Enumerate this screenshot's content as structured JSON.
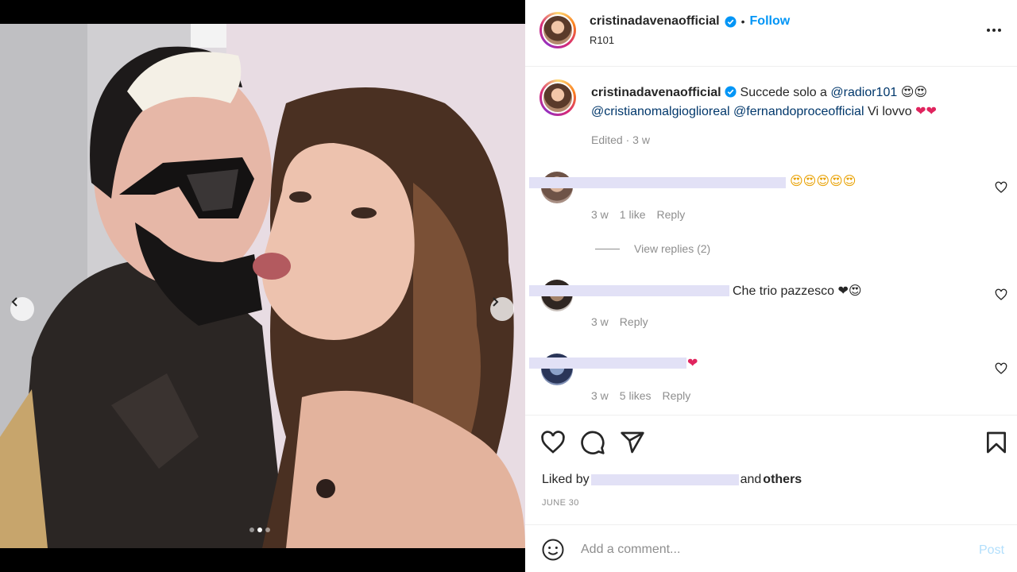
{
  "post": {
    "username": "cristinadavenaofficial",
    "separator": "•",
    "follow_label": "Follow",
    "location": "R101",
    "more_icon": "more-horizontal-icon"
  },
  "media": {
    "total_slides": 3,
    "active_slide": 2,
    "prev_icon": "chevron-left-icon",
    "next_icon": "chevron-right-icon"
  },
  "caption": {
    "username": "cristinadavenaofficial",
    "text_1": "Succede solo a",
    "mention_1": "@radior101",
    "emoji_1": "😍😍",
    "mention_2": "@cristianomalgioglioreal",
    "mention_3": "@fernandoproceofficial",
    "text_2": "Vi lovvo",
    "emoji_2": "❤❤",
    "meta": "Edited · 3 w"
  },
  "comments": [
    {
      "text": "😍😍😍😍😍",
      "time": "3 w",
      "likes": "1 like",
      "reply": "Reply"
    },
    {
      "text": "Che trio pazzesco ❤😍",
      "time": "3 w",
      "likes": "",
      "reply": "Reply"
    },
    {
      "text": "❤",
      "time": "3 w",
      "likes": "5 likes",
      "reply": "Reply"
    }
  ],
  "view_replies": "View replies (2)",
  "actions": {
    "liked_prefix": "Liked by",
    "liked_and": "and",
    "liked_others": "others",
    "date": "JUNE 30"
  },
  "add_comment": {
    "placeholder": "Add a comment...",
    "post_label": "Post"
  },
  "colors": {
    "link": "#0095f6",
    "mention": "#00376b",
    "muted": "#8e8e8e",
    "redaction": "#e2e1f6",
    "post_disabled": "#b2dffc"
  }
}
